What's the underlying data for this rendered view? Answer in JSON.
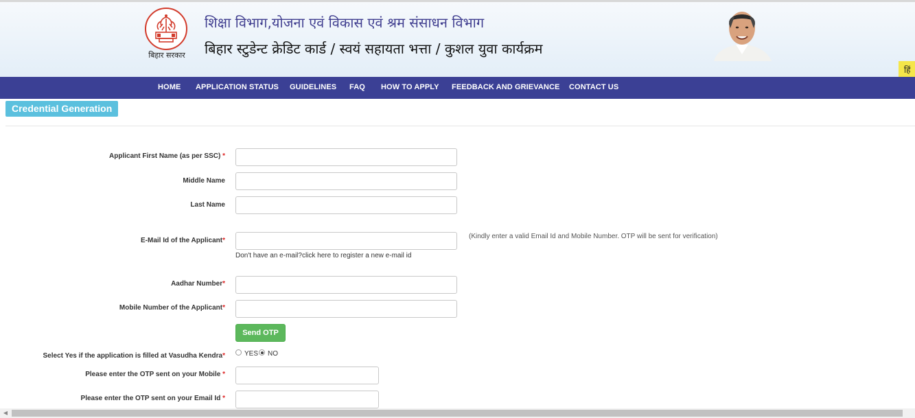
{
  "header": {
    "emblem_caption": "बिहार सरकार",
    "title_hindi_1": "शिक्षा विभाग,योजना एवं विकास एवं श्रम संसाधन विभाग",
    "title_hindi_2": "बिहार स्टुडेन्ट क्रेडिट कार्ड / स्वयं सहायता भत्ता / कुशल युवा कार्यक्रम",
    "language_button": "हिं"
  },
  "nav": {
    "items": [
      "HOME",
      "APPLICATION STATUS",
      "GUIDELINES",
      "FAQ",
      "HOW TO APPLY",
      "FEEDBACK AND GRIEVANCE",
      "CONTACT US"
    ]
  },
  "section": {
    "title": "Credential Generation"
  },
  "form": {
    "first_name_label": "Applicant First Name (as per SSC)",
    "middle_name_label": "Middle Name",
    "last_name_label": "Last Name",
    "email_label": "E-Mail Id of the Applicant",
    "email_hint": "(Kindly enter a valid Email Id and Mobile Number. OTP will be sent for verification)",
    "email_register_link": "Don't have an e-mail?click here to register a new e-mail id",
    "aadhar_label": "Aadhar Number",
    "mobile_label": "Mobile Number of the Applicant",
    "send_otp_label": "Send OTP",
    "vasudha_label": "Select Yes if the application is filled at Vasudha Kendra",
    "radio_yes_label": "YES",
    "radio_no_label": "NO",
    "radio_selected": "NO",
    "otp_mobile_label": "Please enter the OTP sent on your Mobile",
    "otp_email_label": "Please enter the OTP sent on your Email Id",
    "required_mark": "*",
    "values": {
      "first_name": "",
      "middle_name": "",
      "last_name": "",
      "email": "",
      "aadhar": "",
      "mobile": "",
      "otp_mobile": "",
      "otp_email": ""
    }
  },
  "colors": {
    "nav_bg": "#3b4095",
    "title_hindi_1": "#3f3d8f",
    "section_badge": "#5bc0de",
    "send_otp": "#5cb85c",
    "required": "#dd2222",
    "emblem": "#d23a2a",
    "language_button": "#f5e64a"
  }
}
